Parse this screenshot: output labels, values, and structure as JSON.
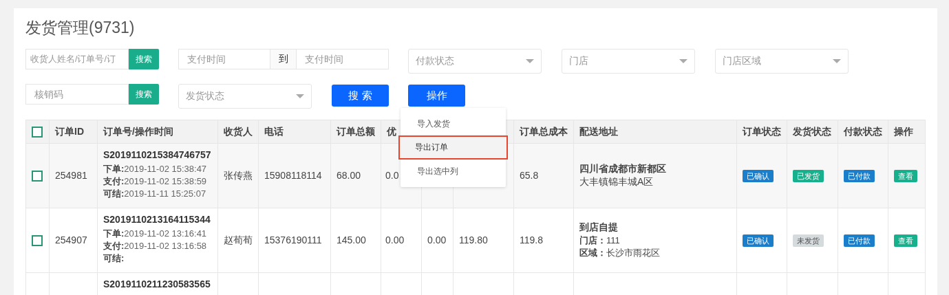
{
  "title": "发货管理(9731)",
  "filters": {
    "keyword": {
      "placeholder": "收货人姓名/订单号/订",
      "button": "搜索"
    },
    "pay_time": {
      "from_placeholder": "支付时间",
      "separator": "到",
      "to_placeholder": "支付时间"
    },
    "selects_row1": [
      {
        "placeholder": "付款状态"
      },
      {
        "placeholder": "门店"
      },
      {
        "placeholder": "门店区域"
      }
    ],
    "code": {
      "placeholder": "核销码",
      "button": "搜索"
    },
    "ship_status": {
      "placeholder": "发货状态"
    },
    "search_button": "搜 索",
    "action_button": "操作"
  },
  "action_menu": [
    {
      "label": "导入发货",
      "highlighted": false
    },
    {
      "label": "导出订单",
      "highlighted": true
    },
    {
      "label": "导出选中列",
      "highlighted": false
    }
  ],
  "table": {
    "columns": [
      {
        "kind": "checkbox",
        "checked": false
      },
      {
        "label": "订单ID"
      },
      {
        "label": "订单号/操作时间"
      },
      {
        "label": "收货人"
      },
      {
        "label": "电话"
      },
      {
        "label": "订单总额"
      },
      {
        "label": "优"
      },
      {},
      {},
      {
        "label": "订单总成本"
      },
      {
        "label": "配送地址"
      },
      {
        "label": "订单状态"
      },
      {
        "label": "发货状态"
      },
      {
        "label": "付款状态"
      },
      {
        "label": "操作"
      }
    ],
    "rows": [
      {
        "checked": false,
        "id": "254981",
        "order_no": "S2019110215384746757",
        "times": [
          "**下单:**2019-11-02 15:38:47",
          "**支付:**2019-11-02 15:38:59",
          "**可结:**2019-11-11 15:25:07"
        ],
        "consignee": "张传燕",
        "phone": "15908118114",
        "total": "68.00",
        "column_6": "0.0",
        "cost": "65.8",
        "address": [
          "**四川省成都市新都区**",
          "大丰镇锦丰城A区"
        ],
        "order_status": {
          "label": "已确认",
          "color": "#1b7ecb"
        },
        "ship_status": {
          "label": "已发货",
          "color": "#17b08d"
        },
        "pay_status": {
          "label": "已付款",
          "color": "#1b7ecb"
        },
        "action": "查看"
      },
      {
        "checked": false,
        "id": "254907",
        "order_no": "S2019110213164115344",
        "times": [
          "**下单:**2019-11-02 13:16:41",
          "**支付:**2019-11-02 13:16:58",
          "**可结:**"
        ],
        "consignee": "赵荀荀",
        "phone": "15376190111",
        "total": "145.00",
        "column_6": "0.00",
        "column_7": "0.00",
        "column_8": "119.80",
        "cost": "119.8",
        "address": [
          "**到店自提**",
          "**门店：**111",
          "**区域：**长沙市雨花区"
        ],
        "order_status": {
          "label": "已确认",
          "color": "#1b7ecb"
        },
        "ship_status": {
          "label": "未发货",
          "color": "#d5dadd"
        },
        "pay_status": {
          "label": "已付款",
          "color": "#1b7ecb"
        },
        "action": "查看"
      },
      {
        "order_no": "S2019110211230583565"
      }
    ]
  }
}
